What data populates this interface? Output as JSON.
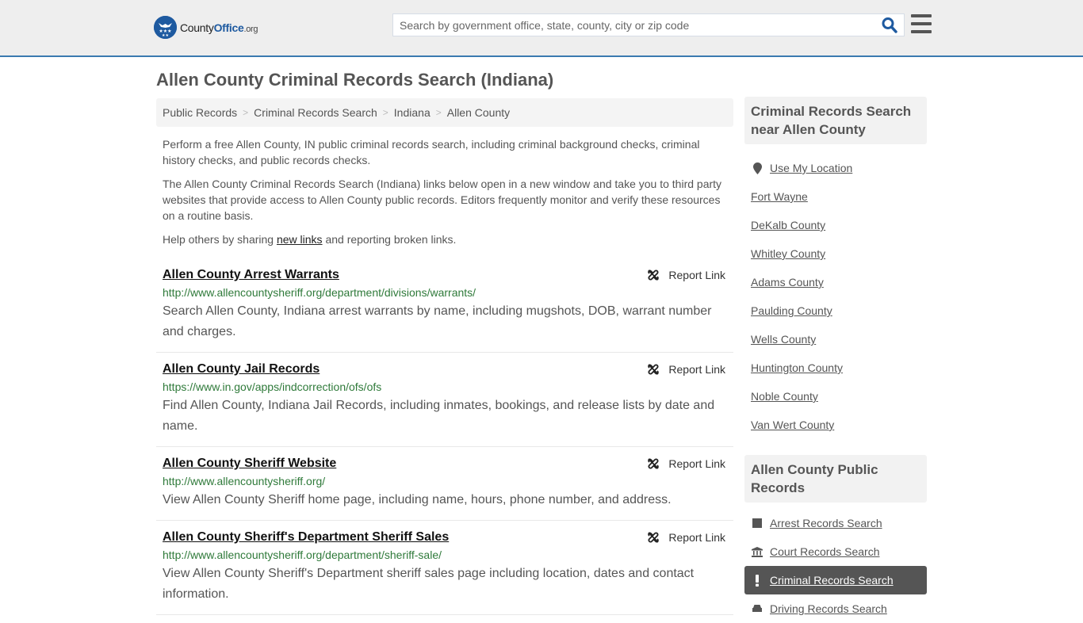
{
  "header": {
    "logo": {
      "prefix": "County",
      "brand": "Office",
      "suffix": ".org"
    },
    "search_placeholder": "Search by government office, state, county, city or zip code",
    "search_value": "",
    "brand_color": "#1e5aa0",
    "border_color": "#3b7ab0"
  },
  "page": {
    "title": "Allen County Criminal Records Search (Indiana)"
  },
  "breadcrumb": [
    {
      "label": "Public Records"
    },
    {
      "label": "Criminal Records Search"
    },
    {
      "label": "Indiana"
    },
    {
      "label": "Allen County"
    }
  ],
  "intro": {
    "p1": "Perform a free Allen County, IN public criminal records search, including criminal background checks, criminal history checks, and public records checks.",
    "p2": "The Allen County Criminal Records Search (Indiana) links below open in a new window and take you to third party websites that provide access to Allen County public records. Editors frequently monitor and verify these resources on a routine basis.",
    "p3_before": "Help others by sharing ",
    "p3_link": "new links",
    "p3_after": " and reporting broken links."
  },
  "report_label": "Report Link",
  "results": [
    {
      "title": "Allen County Arrest Warrants",
      "url": "http://www.allencountysheriff.org/department/divisions/warrants/",
      "desc": "Search Allen County, Indiana arrest warrants by name, including mugshots, DOB, warrant number and charges."
    },
    {
      "title": "Allen County Jail Records",
      "url": "https://www.in.gov/apps/indcorrection/ofs/ofs",
      "desc": "Find Allen County, Indiana Jail Records, including inmates, bookings, and release lists by date and name."
    },
    {
      "title": "Allen County Sheriff Website",
      "url": "http://www.allencountysheriff.org/",
      "desc": "View Allen County Sheriff home page, including name, hours, phone number, and address."
    },
    {
      "title": "Allen County Sheriff's Department Sheriff Sales",
      "url": "http://www.allencountysheriff.org/department/sheriff-sale/",
      "desc": "View Allen County Sheriff's Department sheriff sales page including location, dates and contact information."
    }
  ],
  "sidebar": {
    "nearby_title": "Criminal Records Search near Allen County",
    "use_location": "Use My Location",
    "nearby": [
      "Fort Wayne",
      "DeKalb County",
      "Whitley County",
      "Adams County",
      "Paulding County",
      "Wells County",
      "Huntington County",
      "Noble County",
      "Van Wert County"
    ],
    "records_title": "Allen County Public Records",
    "records": [
      {
        "label": "Arrest Records Search",
        "icon": "square-icon",
        "active": false
      },
      {
        "label": "Court Records Search",
        "icon": "courthouse-icon",
        "active": false
      },
      {
        "label": "Criminal Records Search",
        "icon": "exclamation-icon",
        "active": true
      },
      {
        "label": "Driving Records Search",
        "icon": "car-icon",
        "active": false
      }
    ]
  }
}
